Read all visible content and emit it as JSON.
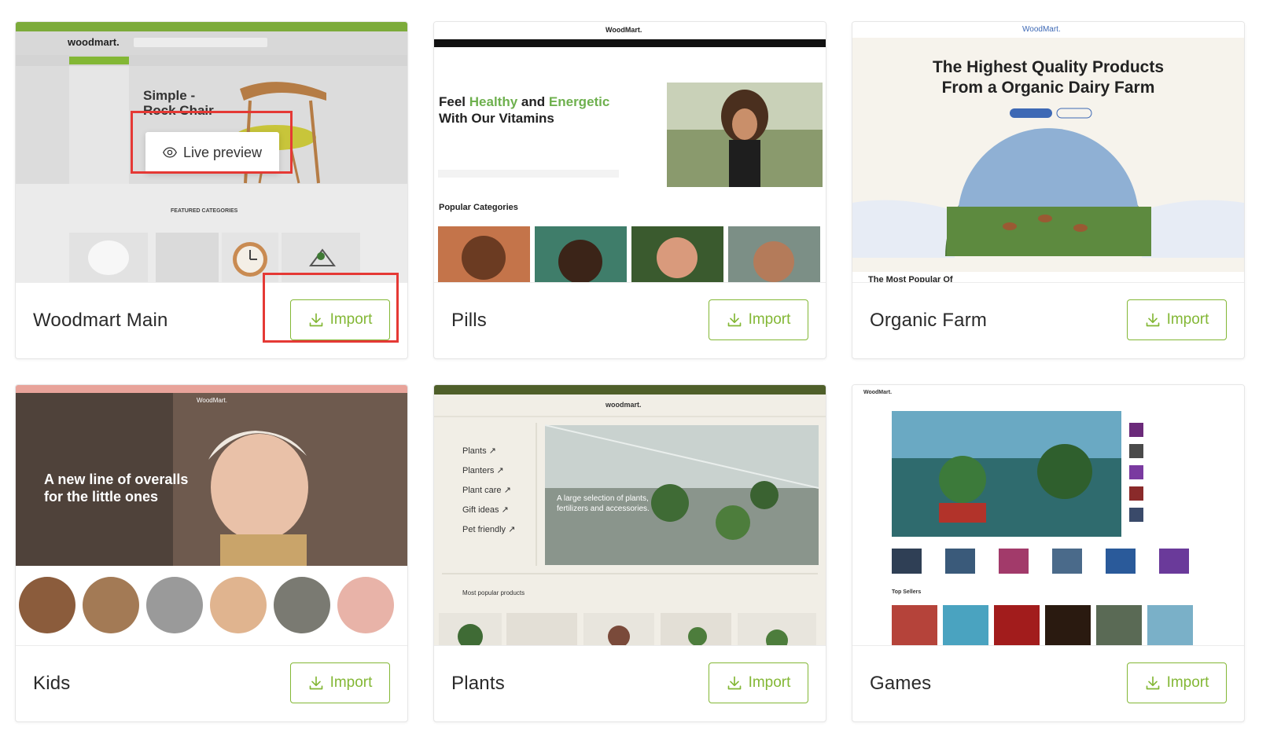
{
  "colors": {
    "accent": "#83b735",
    "highlight": "#e53935"
  },
  "common": {
    "import_label": "Import",
    "live_preview_label": "Live preview"
  },
  "cards": [
    {
      "title": "Woodmart Main",
      "preview": {
        "logo": "woodmart.",
        "hero_text": "Simple - Rock Chair",
        "section_heading": "FEATURED CATEGORIES"
      }
    },
    {
      "title": "Pills",
      "preview": {
        "logo": "WoodMart.",
        "hero_word_feel": "Feel",
        "hero_word_healthy": "Healthy",
        "hero_word_and": "and",
        "hero_word_energetic": "Energetic",
        "hero_line2": "With Our Vitamins",
        "section_heading": "Popular Categories"
      }
    },
    {
      "title": "Organic Farm",
      "preview": {
        "logo": "WoodMart.",
        "hero_line1": "The Highest Quality Products",
        "hero_line2": "From a Organic Dairy Farm",
        "bottom_text": "The Most Popular Of"
      }
    },
    {
      "title": "Kids",
      "preview": {
        "logo": "WoodMart.",
        "hero_line1": "A new line of overalls",
        "hero_line2": "for the little ones"
      }
    },
    {
      "title": "Plants",
      "preview": {
        "logo": "woodmart.",
        "menu": [
          "Plants ↗",
          "Planters ↗",
          "Plant care ↗",
          "Gift ideas ↗",
          "Pet friendly ↗"
        ],
        "hero_text": "A large selection of plants, fertilizers and accessories.",
        "section_heading": "Most popular products"
      }
    },
    {
      "title": "Games",
      "preview": {
        "logo": "WoodMart.",
        "section_heading": "Top Sellers"
      }
    }
  ]
}
